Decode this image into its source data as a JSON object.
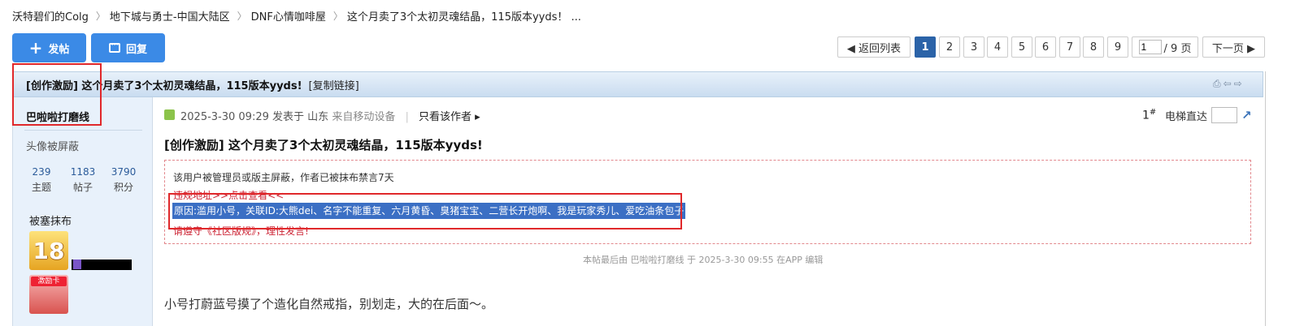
{
  "breadcrumb": [
    "沃特碧们的Colg",
    "地下城与勇士-中国大陆区",
    "DNF心情咖啡屋",
    "这个月卖了3个太初灵魂结晶，115版本yyds！ ..."
  ],
  "actions": {
    "post": "发帖",
    "reply": "回复"
  },
  "pagination": {
    "back": "◀ 返回列表",
    "pages": [
      "1",
      "2",
      "3",
      "4",
      "5",
      "6",
      "7",
      "8",
      "9"
    ],
    "current": "1",
    "page_input": "1",
    "total": "/ 9 页",
    "next": "下一页 ▶"
  },
  "thread": {
    "title": "[创作激励] 这个月卖了3个太初灵魂结晶，115版本yyds!",
    "copy_link": "[复制链接]",
    "toolbar_icons": [
      "print-icon",
      "prev-thread-icon",
      "next-thread-icon"
    ]
  },
  "author": {
    "name": "巴啦啦打磨线",
    "avatar_hidden": "头像被屏蔽",
    "stats": [
      {
        "value": "239",
        "label": "主题"
      },
      {
        "value": "1183",
        "label": "帖子"
      },
      {
        "value": "3790",
        "label": "积分"
      }
    ],
    "medal_title": "被塞抹布",
    "medal1_text": "18",
    "medal2_text": "激励卡"
  },
  "post": {
    "meta_date": "2025-3-30 09:29",
    "meta_posted": "发表于",
    "meta_location": "山东",
    "meta_device": "来自移动设备",
    "only_author": "只看该作者",
    "floor": "1",
    "floor_suffix": "#",
    "jump_label": "电梯直达",
    "title": "[创作激励] 这个月卖了3个太初灵魂结晶，115版本yyds!",
    "notice_line1": "该用户被管理员或版主屏蔽，作者已被抹布禁言7天",
    "notice_line2": "违规地址>>点击查看<<",
    "notice_reason": "原因:滥用小号，关联ID:大熊dei、名字不能重复、六月黄昏、臭猪宝宝、二营长开炮啊、我是玩家秀儿、爱吃油条包子",
    "notice_line4": "请遵守《社区版规》，理性发言!",
    "edit_note": "本帖最后由 巴啦啦打磨线 于 2025-3-30 09:55 在APP 编辑",
    "body": "小号打蔚蓝号摸了个造化自然戒指，别划走，大的在后面～。"
  },
  "colors": {
    "accent": "#3b8ae6",
    "current_page": "#2b63a8",
    "highlight": "#3b6fc4",
    "annotation": "#e0282b"
  }
}
